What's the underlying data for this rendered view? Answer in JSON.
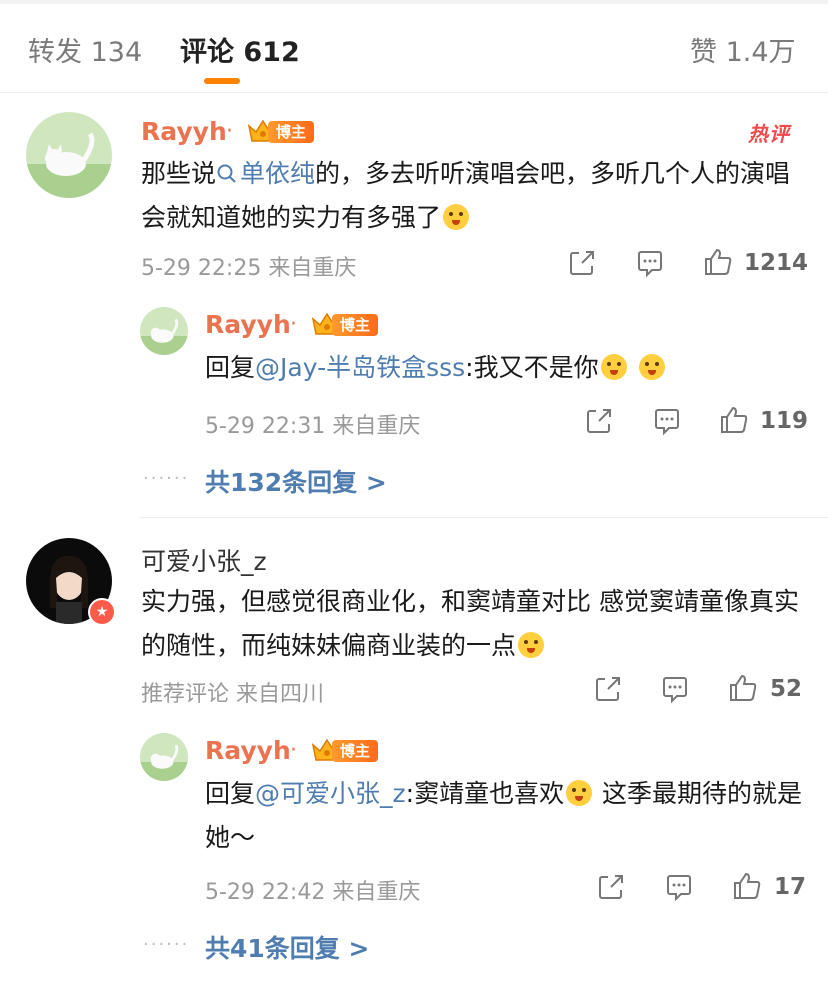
{
  "tabs": {
    "repost": "转发 134",
    "comments": "评论 612",
    "likes": "赞 1.4万"
  },
  "badge_label": "博主",
  "hot_label": "热评",
  "comments": [
    {
      "author": "Rayyh",
      "text_before": "那些说",
      "topic": "单依纯",
      "text_after": "的，多去听听演唱会吧，多听几个人的演唱会就知道她的实力有多强了",
      "meta": "5-29 22:25 来自重庆",
      "likes": "1214",
      "reply": {
        "author": "Rayyh",
        "prefix": "回复",
        "mention": "@Jay-半岛铁盒sss",
        "text": ":我又不是你",
        "meta": "5-29 22:31 来自重庆",
        "likes": "119"
      },
      "more": "共132条回复 >"
    },
    {
      "author": "可爱小张_z",
      "text": "实力强，但感觉很商业化，和窦靖童对比 感觉窦靖童像真实的随性，而纯妹妹偏商业装的一点",
      "meta": "推荐评论 来自四川",
      "likes": "52",
      "reply": {
        "author": "Rayyh",
        "prefix": "回复",
        "mention": "@可爱小张_z",
        "text": ":窦靖童也喜欢",
        "text_after": " 这季最期待的就是她～",
        "meta": "5-29 22:42 来自重庆",
        "likes": "17"
      },
      "more": "共41条回复 >"
    }
  ],
  "colors": {
    "accent": "#ff8200",
    "name": "#eb7350",
    "link": "#507daf",
    "hot": "#f04a4a"
  }
}
